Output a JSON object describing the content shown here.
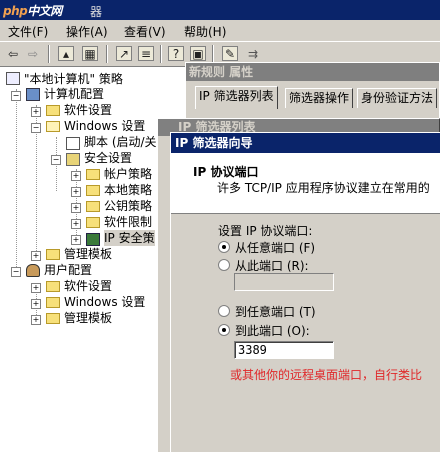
{
  "titlebar": {
    "logo_php": "php",
    "logo_cn": "中文网",
    "title_tail": "器"
  },
  "menu": [
    {
      "label": "文件(F)"
    },
    {
      "label": "操作(A)"
    },
    {
      "label": "查看(V)"
    },
    {
      "label": "帮助(H)"
    }
  ],
  "toolbar": {
    "icons": [
      "back-arrow-icon",
      "forward-arrow-icon",
      "up-folder-icon",
      "show-tree-icon",
      "export-icon",
      "properties-icon",
      "help-icon",
      "console-icon",
      "new-item-icon",
      "actions-icon"
    ]
  },
  "tree": {
    "root_label": "\"本地计算机\" 策略",
    "computer_config": "计算机配置",
    "software_settings": "软件设置",
    "windows_settings": "Windows 设置",
    "scripts": "脚本 (启动/关",
    "security_settings": "安全设置",
    "account_policy": "帐户策略",
    "local_policy": "本地策略",
    "public_key_policy": "公钥策略",
    "software_restriction": "软件限制",
    "ip_security": "IP 安全策",
    "admin_templates": "管理模板",
    "user_config": "用户配置",
    "user_software": "软件设置",
    "user_windows": "Windows 设置",
    "user_admin_templates": "管理模板"
  },
  "props_dialog": {
    "title": "新规则 属性",
    "tabs": [
      "IP 筛选器列表",
      "筛选器操作",
      "身份验证方法"
    ]
  },
  "filter_list_dialog": {
    "title": "IP 筛选器列表"
  },
  "wizard": {
    "title": "IP 筛选器向导",
    "heading": "IP 协议端口",
    "subheading": "许多 TCP/IP 应用程序协议建立在常用的",
    "set_port_label": "设置 IP 协议端口:",
    "from_any_port": "从任意端口 (F)",
    "from_this_port": "从此端口 (R):",
    "from_port_value": "",
    "to_any_port": "到任意端口 (T)",
    "to_this_port": "到此端口 (O):",
    "to_port_value": "3389",
    "from_selection": "any",
    "to_selection": "this"
  },
  "annotation": {
    "text": "或其他你的远程桌面端口，自行类比",
    "color": "#e0282a"
  }
}
